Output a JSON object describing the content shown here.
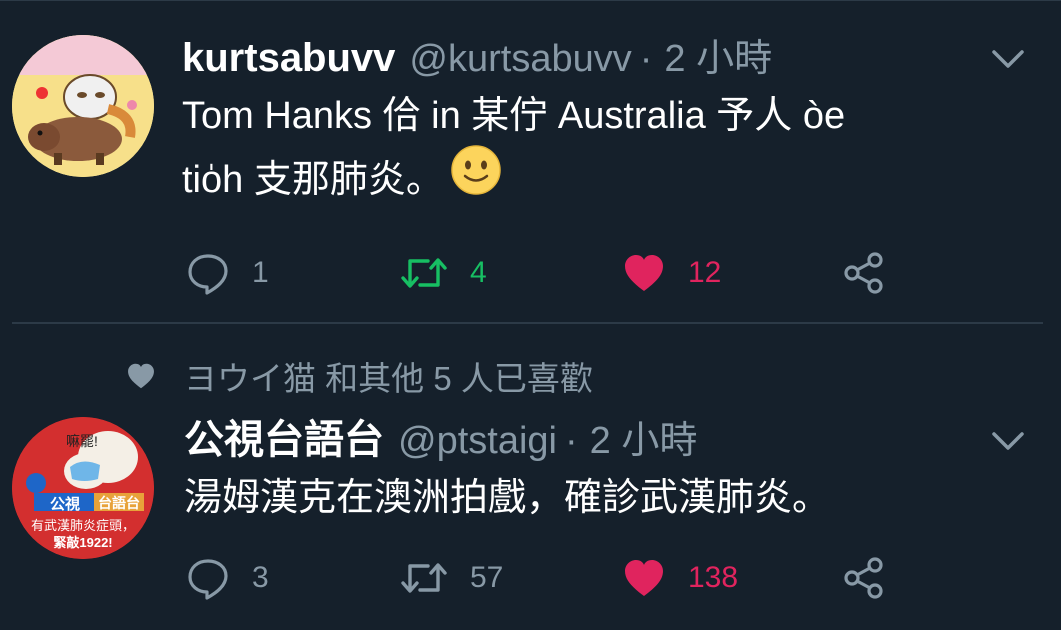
{
  "tweets": [
    {
      "display_name": "kurtsabuvv",
      "handle": "@kurtsabuvv",
      "time": "2 小時",
      "text_line1": "Tom Hanks 佮 in 某佇 Australia 予人 òe",
      "text_line2": "tio̍h 支那肺炎。",
      "emoji": "slightly-smiling-face-emoji",
      "replies": "1",
      "retweets": "4",
      "likes": "12",
      "retweeted": true,
      "liked": true
    },
    {
      "social_context": "ヨウイ猫 和其他 5 人已喜歡",
      "display_name": "公視台語台",
      "handle": "@ptstaigi",
      "time": "2 小時",
      "text_line1": "湯姆漢克在澳洲拍戲，確診武漢肺炎。",
      "avatar_text": {
        "bubble": "嘛罷!",
        "brand": "公視",
        "channel": "台語台",
        "line1": "有武漢肺炎症頭，",
        "line2": "緊敲1922!"
      },
      "replies": "3",
      "retweets": "57",
      "likes": "138",
      "retweeted": false,
      "liked": true
    }
  ],
  "colors": {
    "background": "#15202b",
    "secondary_text": "#8899a6",
    "retweet_active": "#17bf63",
    "like_active": "#e0245e",
    "divider": "#2c3a47"
  }
}
